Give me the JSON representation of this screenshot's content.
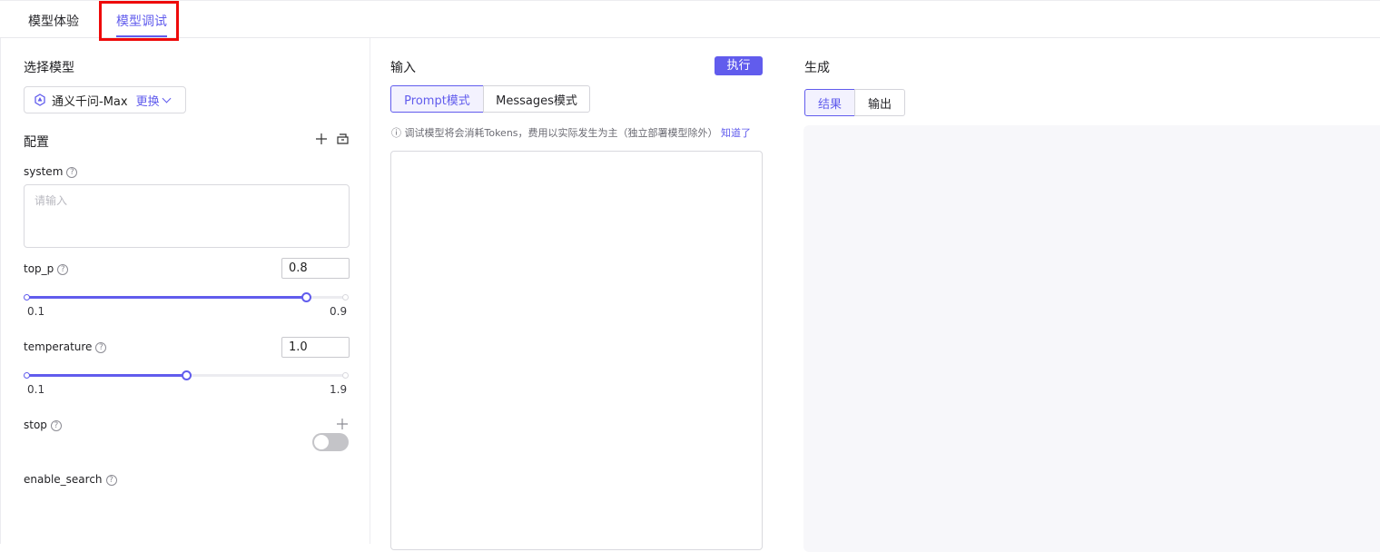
{
  "tabs": [
    {
      "label": "模型体验",
      "active": false
    },
    {
      "label": "模型调试",
      "active": true
    }
  ],
  "left": {
    "select_model_title": "选择模型",
    "model_name": "通义千问-Max",
    "change_label": "更换",
    "config_title": "配置",
    "add_icon": "plus-icon",
    "lib_icon": "library-icon",
    "system_label": "system",
    "system_placeholder": "请输入",
    "top_p": {
      "label": "top_p",
      "value": "0.8",
      "min": "0.1",
      "max": "0.9"
    },
    "temperature": {
      "label": "temperature",
      "value": "1.0",
      "min": "0.1",
      "max": "1.9"
    },
    "stop_label": "stop",
    "enable_search_label": "enable_search",
    "enable_search_on": false
  },
  "middle": {
    "title": "输入",
    "execute_label": "执行",
    "mode_prompt": "Prompt模式",
    "mode_messages": "Messages模式",
    "notice": "调试模型将会消耗Tokens，费用以实际发生为主（独立部署模型除外）",
    "notice_link": "知道了"
  },
  "right": {
    "title": "生成",
    "tab_result": "结果",
    "tab_output": "输出"
  },
  "colors": {
    "accent": "#615ced",
    "highlight_box": "#ee0a0a"
  }
}
